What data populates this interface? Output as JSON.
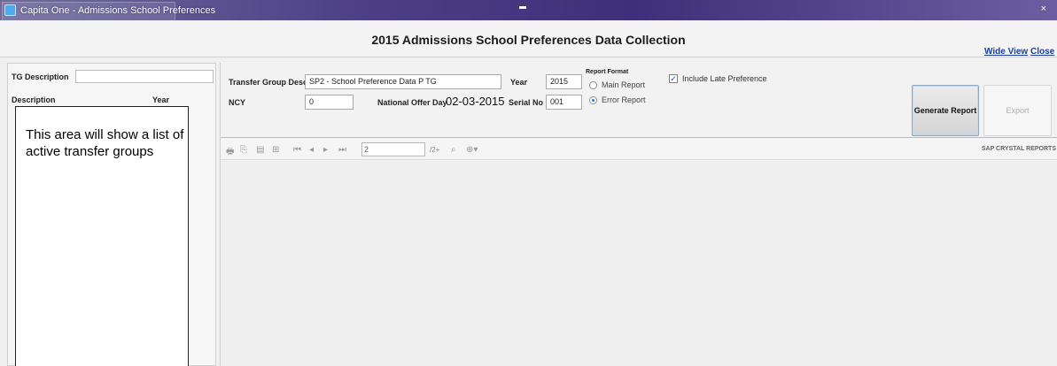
{
  "window": {
    "title": "Capita One - Admissions School Preferences",
    "close_glyph": "×"
  },
  "header": {
    "title": "2015 Admissions School Preferences Data Collection",
    "wide_view_label": "Wide View",
    "close_label": "Close"
  },
  "left_panel": {
    "tg_description_label": "TG Description",
    "tg_description_value": "",
    "columns": [
      "Description",
      "Year"
    ],
    "placeholder_text": "This area will show a list of active transfer groups"
  },
  "form": {
    "transfer_group_label": "Transfer Group Desc",
    "transfer_group_value": "SP2 - School Preference Data P TG",
    "year_label": "Year",
    "year_value": "2015",
    "ncy_label": "NCY",
    "ncy_value": "0",
    "offer_day_label": "National Offer Day",
    "offer_day_value": "02-03-2015",
    "serial_label": "Serial No",
    "serial_value": "001",
    "report_format_label": "Report Format",
    "main_report_label": "Main Report",
    "error_report_label": "Error Report",
    "selected_format": "Error Report",
    "include_late_label": "Include Late Preference",
    "include_late_checked": true,
    "generate_label": "Generate Report",
    "export_label": "Export"
  },
  "report_viewer": {
    "page_value": "2",
    "page_total": "/2+",
    "brand": "SAP CRYSTAL REPORTS",
    "toolbar_icons": [
      "print-icon",
      "export-icon",
      "group-tree-icon",
      "parameter-icon",
      "first-page-icon",
      "prev-page-icon",
      "next-page-icon",
      "last-page-icon",
      "find-icon",
      "zoom-icon"
    ]
  },
  "colors": {
    "title_gradient": "#4c3f86",
    "link": "#1a3f9c",
    "radio_selected": "#2f6bd6"
  }
}
